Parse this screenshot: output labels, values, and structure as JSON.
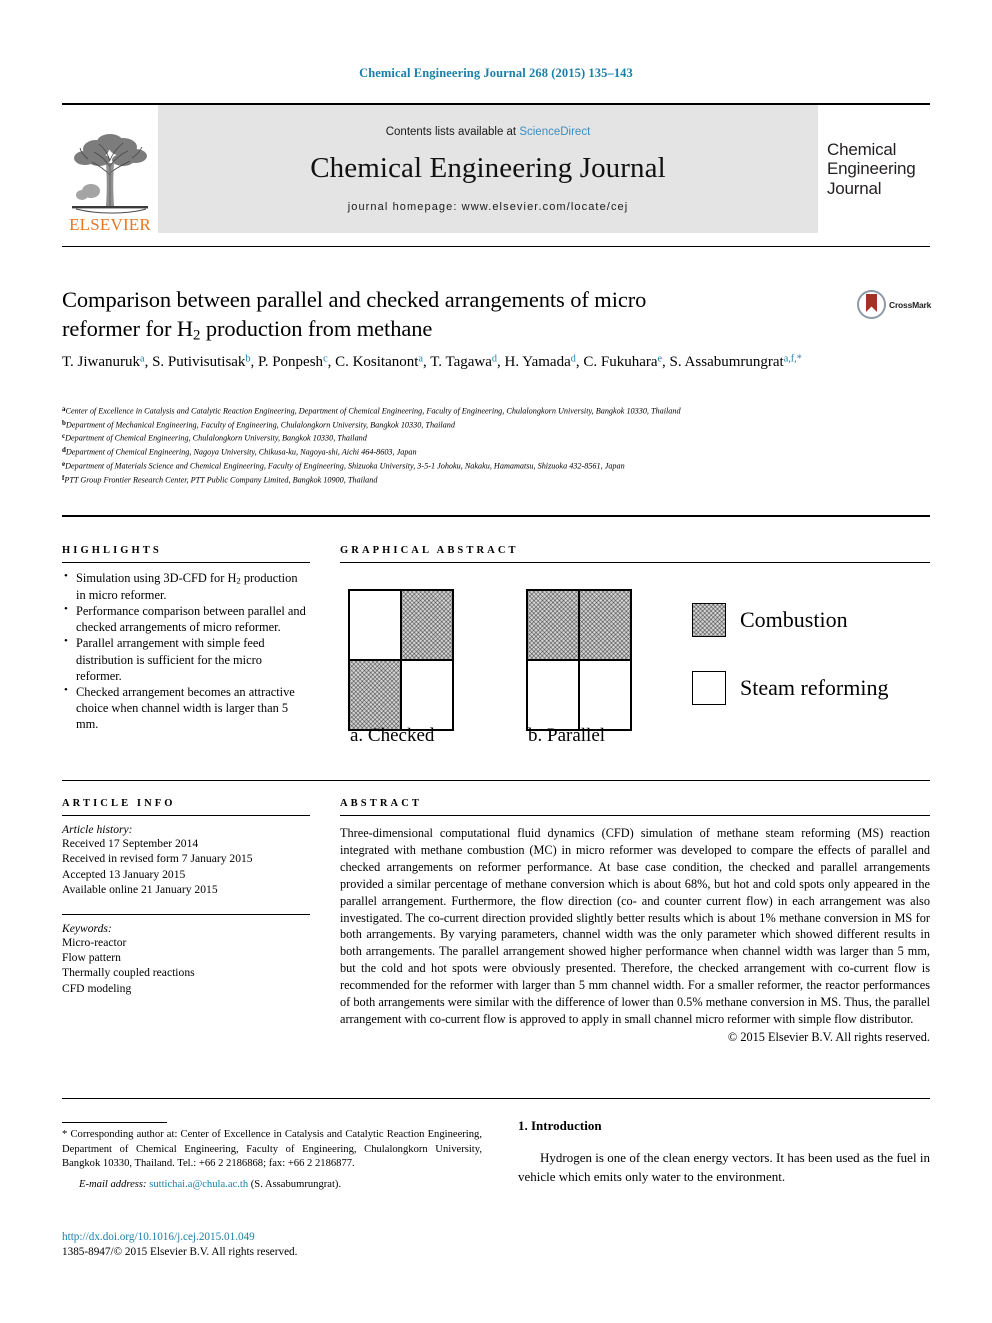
{
  "running_head": "Chemical Engineering Journal 268 (2015) 135–143",
  "masthead": {
    "contents_prefix": "Contents lists available at ",
    "sciencedirect": "ScienceDirect",
    "journal_title": "Chemical Engineering Journal",
    "homepage": "journal homepage: www.elsevier.com/locate/cej",
    "elsevier_wordmark": "ELSEVIER",
    "cover_lines": [
      "Chemical",
      "Engineering",
      "Journal"
    ],
    "link_color": "#3c8dbc"
  },
  "article": {
    "title_line1": "Comparison between parallel and checked arrangements of micro",
    "title_line2_pre": "reformer for H",
    "title_line2_sub": "2",
    "title_line2_post": " production from methane",
    "crossmark_label": "CrossMark",
    "authors": [
      {
        "name": "T. Jiwanuruk",
        "sup": "a",
        "sep": ", "
      },
      {
        "name": "S. Putivisutisak",
        "sup": "b",
        "sep": ", "
      },
      {
        "name": "P. Ponpesh",
        "sup": "c",
        "sep": ", "
      },
      {
        "name": "C. Kositanont",
        "sup": "a",
        "sep": ", "
      },
      {
        "name": "T. Tagawa",
        "sup": "d",
        "sep": ", "
      },
      {
        "name": "H. Yamada",
        "sup": "d",
        "sep": ", "
      },
      {
        "name": "C. Fukuhara",
        "sup": "e",
        "sep": ", "
      },
      {
        "name": "S. Assabumrungrat",
        "sup": "a,f,*",
        "sep": ""
      }
    ],
    "affiliations": [
      {
        "mark": "a",
        "text": "Center of Excellence in Catalysis and Catalytic Reaction Engineering, Department of Chemical Engineering, Faculty of Engineering, Chulalongkorn University, Bangkok 10330, Thailand"
      },
      {
        "mark": "b",
        "text": "Department of Mechanical Engineering, Faculty of Engineering, Chulalongkorn University, Bangkok 10330, Thailand"
      },
      {
        "mark": "c",
        "text": "Department of Chemical Engineering, Chulalongkorn University, Bangkok 10330, Thailand"
      },
      {
        "mark": "d",
        "text": "Department of Chemical Engineering, Nagoya University, Chikusa-ku, Nagoya-shi, Aichi 464-8603, Japan"
      },
      {
        "mark": "e",
        "text": "Department of Materials Science and Chemical Engineering, Faculty of Engineering, Shizuoka University, 3-5-1 Johoku, Nakaku, Hamamatsu, Shizuoka 432-8561, Japan"
      },
      {
        "mark": "f",
        "text": "PTT Group Frontier Research Center, PTT Public Company Limited, Bangkok 10900, Thailand"
      }
    ]
  },
  "highlights": {
    "heading": "HIGHLIGHTS",
    "items": [
      {
        "pre": "Simulation using 3D-CFD for H",
        "sub": "2",
        "post": " production in micro reformer."
      },
      {
        "pre": "Performance comparison between parallel and checked arrangements of micro reformer.",
        "sub": "",
        "post": ""
      },
      {
        "pre": "Parallel arrangement with simple feed distribution is sufficient for the micro reformer.",
        "sub": "",
        "post": ""
      },
      {
        "pre": "Checked arrangement becomes an attractive choice when channel width is larger than 5 mm.",
        "sub": "",
        "post": ""
      }
    ]
  },
  "graphical_abstract": {
    "heading": "GRAPHICAL ABSTRACT",
    "caption_a": "a. Checked",
    "caption_b": "b. Parallel",
    "legend": [
      {
        "label": "Combustion",
        "style": "hatch"
      },
      {
        "label": "Steam reforming",
        "style": "blank"
      }
    ],
    "checked_cells": [
      "blank",
      "hatch",
      "hatch",
      "blank"
    ],
    "parallel_cells": [
      "hatch",
      "hatch",
      "blank",
      "blank"
    ]
  },
  "article_info": {
    "heading": "ARTICLE INFO",
    "history_label": "Article history:",
    "history": [
      "Received 17 September 2014",
      "Received in revised form 7 January 2015",
      "Accepted 13 January 2015",
      "Available online 21 January 2015"
    ],
    "keywords_label": "Keywords:",
    "keywords": [
      "Micro-reactor",
      "Flow pattern",
      "Thermally coupled reactions",
      "CFD modeling"
    ]
  },
  "abstract": {
    "heading": "ABSTRACT",
    "text": "Three-dimensional computational fluid dynamics (CFD) simulation of methane steam reforming (MS) reaction integrated with methane combustion (MC) in micro reformer was developed to compare the effects of parallel and checked arrangements on reformer performance. At base case condition, the checked and parallel arrangements provided a similar percentage of methane conversion which is about 68%, but hot and cold spots only appeared in the parallel arrangement. Furthermore, the flow direction (co- and counter current flow) in each arrangement was also investigated. The co-current direction provided slightly better results which is about 1% methane conversion in MS for both arrangements. By varying parameters, channel width was the only parameter which showed different results in both arrangements. The parallel arrangement showed higher performance when channel width was larger than 5 mm, but the cold and hot spots were obviously presented. Therefore, the checked arrangement with co-current flow is recommended for the reformer with larger than 5 mm channel width. For a smaller reformer, the reactor performances of both arrangements were similar with the difference of lower than 0.5% methane conversion in MS. Thus, the parallel arrangement with co-current flow is approved to apply in small channel micro reformer with simple flow distributor.",
    "copyright": "© 2015 Elsevier B.V. All rights reserved."
  },
  "footer": {
    "corresponding": "* Corresponding author at: Center of Excellence in Catalysis and Catalytic Reaction Engineering, Department of Chemical Engineering, Faculty of Engineering, Chulalongkorn University, Bangkok 10330, Thailand. Tel.: +66 2 2186868; fax: +66 2 2186877.",
    "email_label": "E-mail address:",
    "email": "suttichai.a@chula.ac.th",
    "email_suffix": "(S. Assabumrungrat).",
    "doi": "http://dx.doi.org/10.1016/j.cej.2015.01.049",
    "issn_line": "1385-8947/© 2015 Elsevier B.V. All rights reserved."
  },
  "introduction": {
    "heading": "1. Introduction",
    "paragraph": "Hydrogen is one of the clean energy vectors. It has been used as the fuel in vehicle which emits only water to the environment."
  }
}
